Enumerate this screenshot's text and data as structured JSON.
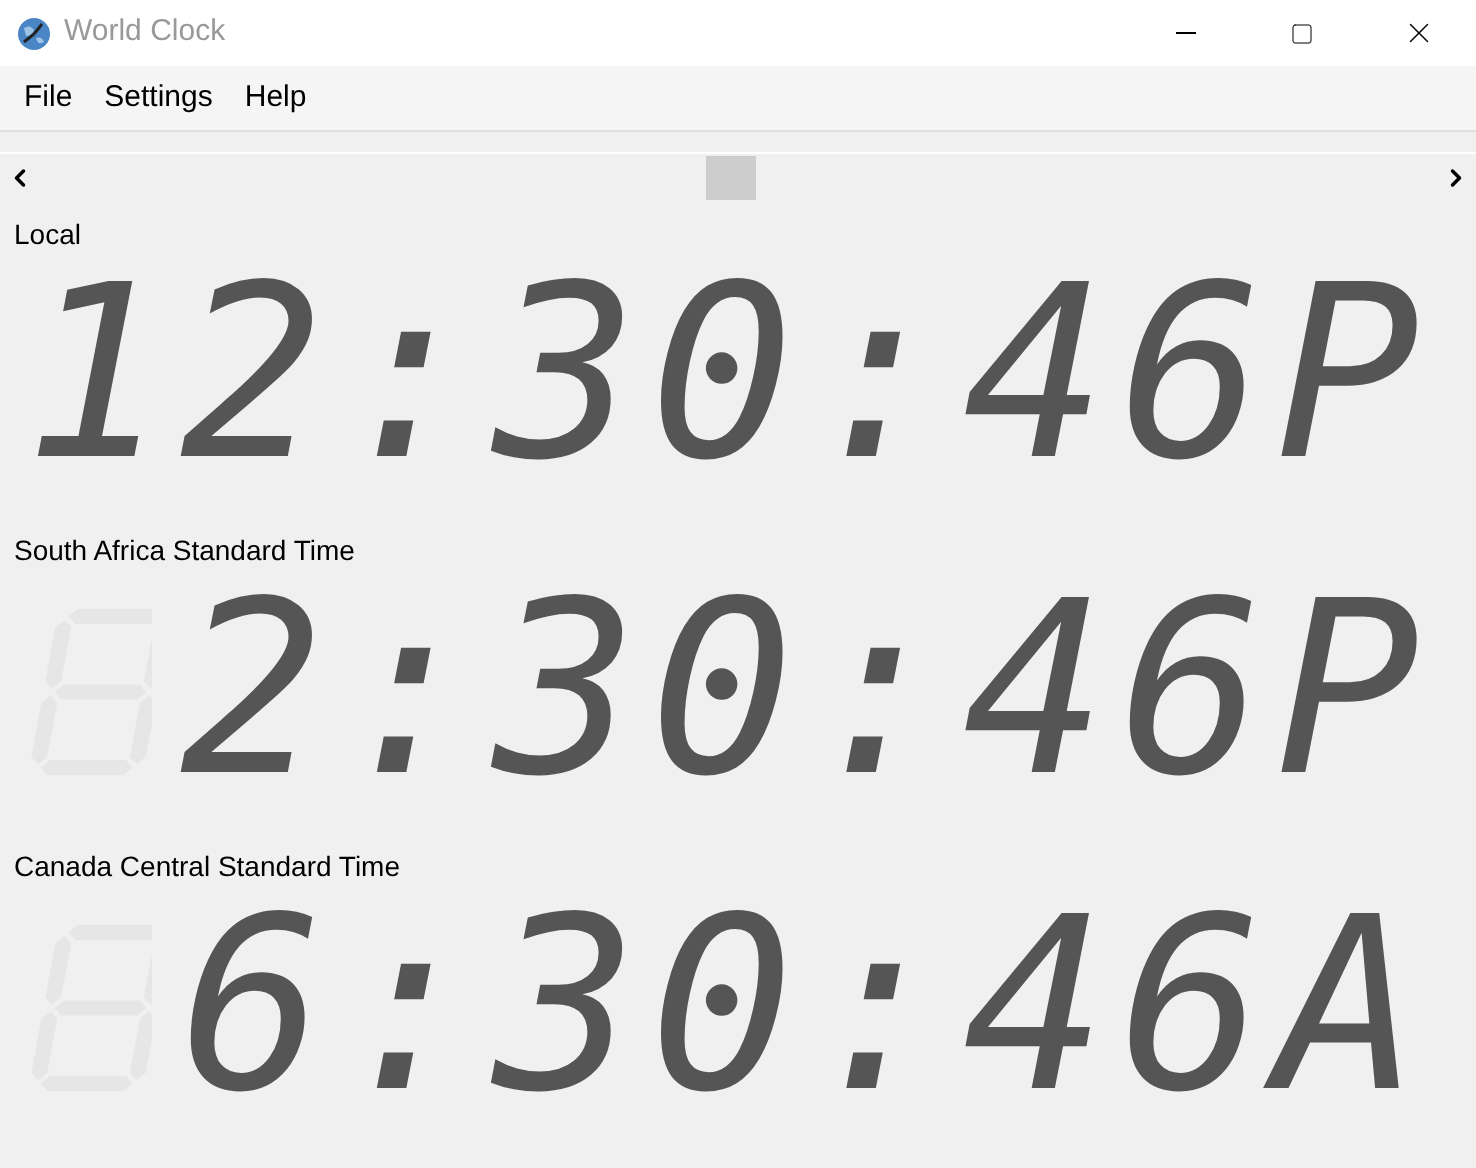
{
  "window": {
    "title": "World Clock"
  },
  "menu": [
    "File",
    "Settings",
    "Help"
  ],
  "clocks": [
    {
      "label": "Local",
      "time": "12:30:46P"
    },
    {
      "label": "South Africa Standard Time",
      "time": "2:30:46P"
    },
    {
      "label": "Canada Central Standard Time",
      "time": "6:30:46A"
    }
  ]
}
